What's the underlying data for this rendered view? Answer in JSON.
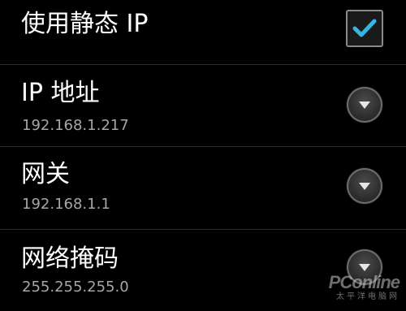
{
  "settings": {
    "static_ip": {
      "title": "使用静态 IP",
      "checked": true
    },
    "ip_address": {
      "title": "IP 地址",
      "value": "192.168.1.217"
    },
    "gateway": {
      "title": "网关",
      "value": "192.168.1.1"
    },
    "netmask": {
      "title": "网络掩码",
      "value": "255.255.255.0"
    }
  },
  "watermark": {
    "brand": "PConline",
    "sub": "太平洋电脑网"
  },
  "colors": {
    "accent": "#33b5e5",
    "background": "#000000",
    "divider": "#2b2b2b"
  }
}
